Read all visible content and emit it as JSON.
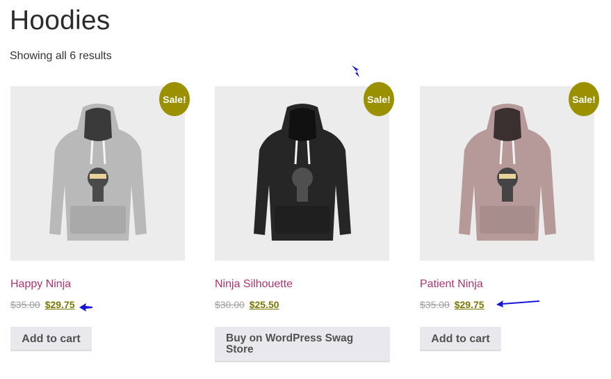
{
  "page": {
    "title": "Hoodies",
    "result_count": "Showing all 6 results"
  },
  "colors": {
    "sale_badge": "#9a9000",
    "product_title": "#b0336e",
    "price_new": "#7a7600",
    "annotation_arrow": "#1515d6",
    "hoodie_grey": "#b9b9b9",
    "hoodie_black": "#262626",
    "hoodie_mauve": "#b69a9a"
  },
  "products": [
    {
      "name": "Happy Ninja",
      "old_price": "$35.00",
      "new_price": "$29.75",
      "sale_badge": "Sale!",
      "button": "Add to cart",
      "hoodie_color": "grey"
    },
    {
      "name": "Ninja Silhouette",
      "old_price": "$30.00",
      "new_price": "$25.50",
      "sale_badge": "Sale!",
      "button": "Buy on WordPress Swag Store",
      "hoodie_color": "black"
    },
    {
      "name": "Patient Ninja",
      "old_price": "$35.00",
      "new_price": "$29.75",
      "sale_badge": "Sale!",
      "button": "Add to cart",
      "hoodie_color": "mauve"
    }
  ]
}
